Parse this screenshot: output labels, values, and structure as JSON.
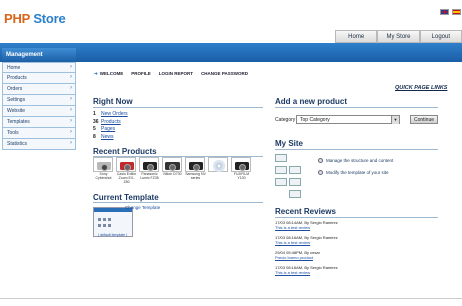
{
  "header": {
    "logo_php": "PHP",
    "logo_store": "Store",
    "flags": [
      "uk-flag-icon",
      "spain-flag-icon"
    ]
  },
  "topnav": [
    "Home",
    "My Store",
    "Logout"
  ],
  "sidebar": {
    "title": "Management",
    "items": [
      "Home",
      "Products",
      "Orders",
      "Settings",
      "Website",
      "Templates",
      "Tools",
      "Statistics"
    ]
  },
  "subnav": [
    "WELCOME",
    "PROFILE",
    "LOGIN REPORT",
    "CHANGE PASSWORD"
  ],
  "quick_links": "QUICK PAGE LINKS",
  "right_now": {
    "title": "Right Now",
    "rows": [
      {
        "num": "1",
        "label": "New Orders"
      },
      {
        "num": "36",
        "label": "Products"
      },
      {
        "num": "5",
        "label": "Pages"
      },
      {
        "num": "8",
        "label": "News"
      }
    ]
  },
  "recent_products": {
    "title": "Recent Products",
    "items": [
      {
        "caption": "Sony Cybershot",
        "icon": "silver-camera-icon"
      },
      {
        "caption": "Casio Exilim Zoom EX-Z80",
        "icon": "red-camera-icon"
      },
      {
        "caption": "Panasonic Lumix FZ35",
        "icon": "black-camera-icon"
      },
      {
        "caption": "Nikon D700",
        "icon": "dslr-camera-icon"
      },
      {
        "caption": "Samsung NV series",
        "icon": "black-camera-icon"
      },
      {
        "caption": "",
        "icon": "disc-icon"
      },
      {
        "caption": "FUJIFILM Y130",
        "icon": "black-camera-icon"
      }
    ]
  },
  "current_template": {
    "title": "Current Template",
    "change_link": "Change Template",
    "default_label": "( default template )"
  },
  "add_product": {
    "title": "Add a new product",
    "category_label": "Category",
    "category_value": "Top Category",
    "continue_label": "Continue"
  },
  "my_site": {
    "title": "My Site",
    "rows": [
      "Manage the structure and content",
      "Modify the template of your site"
    ]
  },
  "recent_reviews": {
    "title": "Recent Reviews",
    "items": [
      {
        "meta": "17/03 08:14AM, By Sergio Ramirez",
        "link": "This is a test review"
      },
      {
        "meta": "17/03 08:16AM, By Sergio Ramirez",
        "link": "This is a test review"
      },
      {
        "meta": "29/04 05:48PM, By cesar",
        "link": "Precio bueno product"
      },
      {
        "meta": "17/03 08:16AM, By Sergio Ramirez",
        "link": "This is a test review"
      }
    ]
  },
  "colors": {
    "brand_orange": "#d9641a",
    "brand_blue": "#2a7fc9",
    "bar_blue": "#1a5ea5"
  }
}
